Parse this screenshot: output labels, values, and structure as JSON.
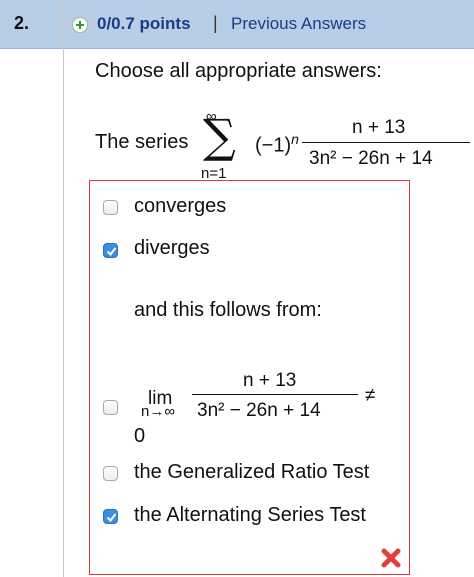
{
  "question": {
    "number": "2.",
    "points": "0/0.7 points",
    "separator": "|",
    "previous_answers": "Previous Answers"
  },
  "prompt": "Choose all appropriate answers:",
  "series": {
    "label": "The series",
    "sum_upper": "∞",
    "sum_lower": "n=1",
    "sign_factor": "(−1)",
    "sign_exponent": "n",
    "numerator": "n + 13",
    "denominator": "3n² − 26n + 14"
  },
  "options": [
    {
      "label": "converges",
      "checked": false
    },
    {
      "label": "diverges",
      "checked": true
    }
  ],
  "follows_text": "and this follows from:",
  "reasons": {
    "limit": {
      "lim": "lim",
      "sub": "n→∞",
      "numerator": "n + 13",
      "denominator": "3n² − 26n + 14",
      "relation": "≠",
      "value": "0",
      "checked": false
    },
    "ratio_test": {
      "label": "the Generalized Ratio Test",
      "checked": false
    },
    "alternating_test": {
      "label": "the Alternating Series Test",
      "checked": true
    }
  },
  "result_icon": "incorrect-x-icon",
  "colors": {
    "header_bg": "#b8cde6",
    "link": "#1a3b8a",
    "box_border": "#d83c3c",
    "checkbox_checked": "#3b8fe0",
    "incorrect": "#e0403a"
  }
}
